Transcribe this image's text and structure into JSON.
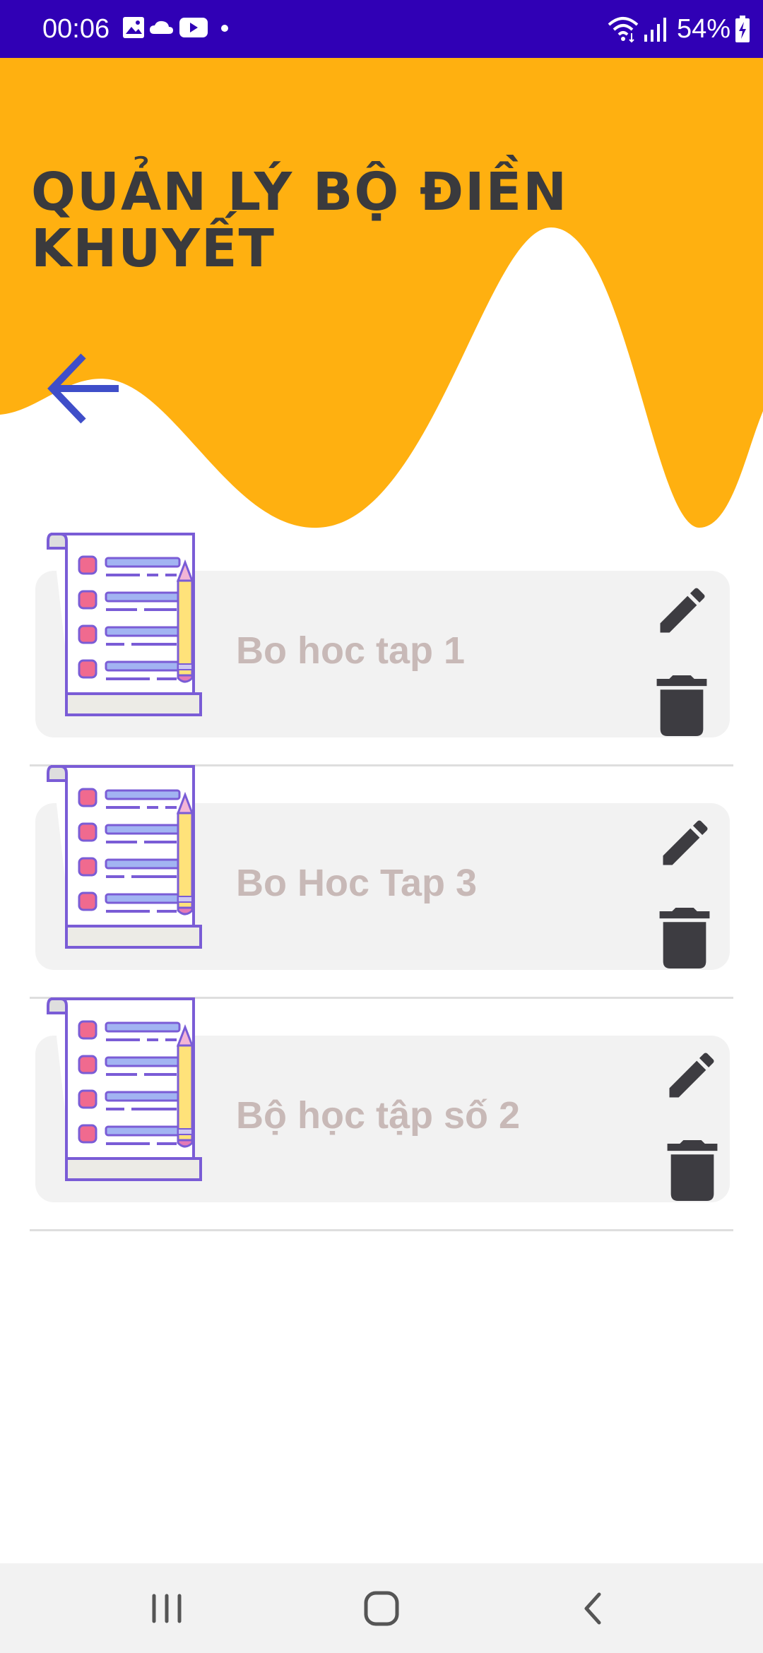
{
  "status_bar": {
    "time": "00:06",
    "battery": "54%",
    "left_icons": [
      "gallery-icon",
      "cloud-icon",
      "youtube-icon",
      "dot-icon"
    ],
    "right_icons": [
      "wifi-icon",
      "signal-icon",
      "battery-charging-icon"
    ]
  },
  "header": {
    "title": "QUẢN LÝ BỘ ĐIỀN KHUYẾT",
    "accent_color": "#ffb010",
    "status_bar_color": "#3000b5",
    "back_icon": "arrow-left-icon"
  },
  "sets": [
    {
      "name": "Bo hoc tap 1"
    },
    {
      "name": "Bo Hoc Tap 3"
    },
    {
      "name": "Bộ học tập số 2"
    }
  ],
  "item_icons": {
    "thumbnail": "checklist-document-icon",
    "edit": "pencil-icon",
    "delete": "trash-icon"
  },
  "nav_bar": {
    "items": [
      "recents-icon",
      "home-icon",
      "back-icon"
    ]
  }
}
